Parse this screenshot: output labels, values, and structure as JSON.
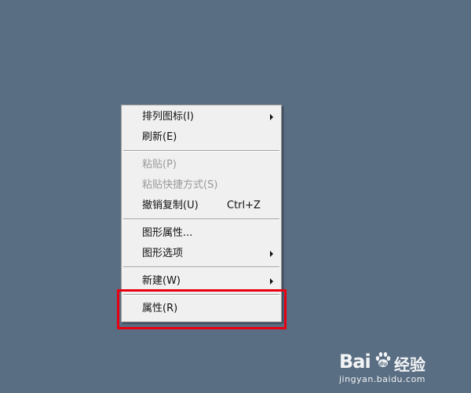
{
  "menu": {
    "groups": [
      [
        {
          "label": "排列图标(I)",
          "has_submenu": true,
          "enabled": true
        },
        {
          "label": "刷新(E)",
          "has_submenu": false,
          "enabled": true
        }
      ],
      [
        {
          "label": "粘贴(P)",
          "has_submenu": false,
          "enabled": false
        },
        {
          "label": "粘贴快捷方式(S)",
          "has_submenu": false,
          "enabled": false
        },
        {
          "label": "撤销复制(U)",
          "shortcut": "Ctrl+Z",
          "has_submenu": false,
          "enabled": true
        }
      ],
      [
        {
          "label": "图形属性...",
          "has_submenu": false,
          "enabled": true
        },
        {
          "label": "图形选项",
          "has_submenu": true,
          "enabled": true
        }
      ],
      [
        {
          "label": "新建(W)",
          "has_submenu": true,
          "enabled": true
        }
      ],
      [
        {
          "label": "属性(R)",
          "has_submenu": false,
          "enabled": true
        }
      ]
    ]
  },
  "highlight": {
    "target": "属性(R)",
    "color": "#e60012"
  },
  "watermark": {
    "brand": "Bai",
    "brand_suffix": "经验",
    "url": "jingyan.baidu.com"
  },
  "colors": {
    "desktop": "#5a6e83",
    "menu_bg": "#f0f0f0",
    "disabled_text": "#9a9a9a"
  }
}
